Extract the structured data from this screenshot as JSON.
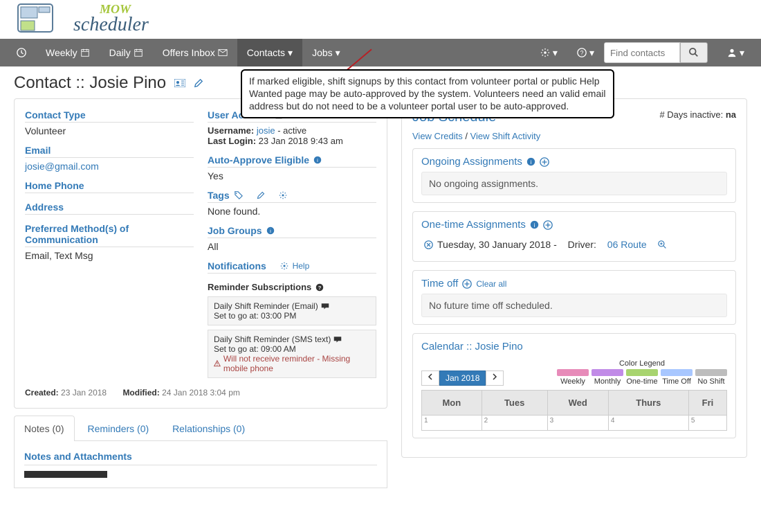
{
  "logo_text_mow": "MOW",
  "logo_text_scheduler": "scheduler",
  "nav": {
    "weekly": "Weekly",
    "daily": "Daily",
    "offers": "Offers Inbox",
    "contacts": "Contacts",
    "jobs": "Jobs",
    "search_placeholder": "Find contacts"
  },
  "tooltip": "If marked eligible, shift signups by this contact from volunteer portal or public Help Wanted page may be auto-approved by the system. Volunteers need an valid email address but do not need to be a volunteer portal user to be auto-approved.",
  "page_title": "Contact :: Josie Pino",
  "left": {
    "contact_type_h": "Contact Type",
    "contact_type": "Volunteer",
    "email_h": "Email",
    "email": "josie@gmail.com",
    "home_phone_h": "Home Phone",
    "address_h": "Address",
    "pref_h": "Preferred Method(s) of Communication",
    "pref": "Email, Text Msg",
    "user_h": "User Account",
    "username_lbl": "Username:",
    "username": "josie",
    "username_status": " - active",
    "lastlogin_lbl": "Last Login:",
    "lastlogin": "23 Jan 2018 9:43 am",
    "auto_h": "Auto-Approve Eligible",
    "auto_v": "Yes",
    "tags_h": "Tags",
    "tags_v": "None found.",
    "jobgroups_h": "Job Groups",
    "jobgroups_v": "All",
    "notif_h": "Notifications",
    "notif_help": "Help",
    "remsub_h": "Reminder Subscriptions",
    "rem1_name": "Daily Shift Reminder (Email)",
    "rem1_time": "Set to go at: 03:00 PM",
    "rem2_name": "Daily Shift Reminder (SMS text)",
    "rem2_time": "Set to go at: 09:00 AM",
    "rem2_warn": "Will not receive reminder - Missing mobile phone",
    "created_lbl": "Created:",
    "created_v": "23 Jan 2018",
    "modified_lbl": "Modified:",
    "modified_v": "24 Jan 2018 3:04 pm"
  },
  "tabs": {
    "notes": "Notes (0)",
    "reminders": "Reminders (0)",
    "relationships": "Relationships (0)",
    "notes_body_h": "Notes and Attachments"
  },
  "right": {
    "jobsched": "Job Schedule",
    "view_credits": "View Credits",
    "sep": " / ",
    "view_activity": "View Shift Activity",
    "days_inactive_lbl": "# Days inactive: ",
    "days_inactive_v": "na",
    "ongoing_h": "Ongoing Assignments",
    "ongoing_body": "No ongoing assignments.",
    "onetime_h": "One-time Assignments",
    "onetime_date": "Tuesday, 30 January 2018 -",
    "onetime_role": "Driver:",
    "onetime_route": "06 Route",
    "timeoff_h": "Time off",
    "timeoff_clear": "Clear all",
    "timeoff_body": "No future time off scheduled.",
    "cal_h": "Calendar :: Josie Pino",
    "month": "Jan 2018",
    "legend_title": "Color Legend",
    "legend": [
      "Weekly",
      "Monthly",
      "One-time",
      "Time Off",
      "No Shift"
    ],
    "legend_colors": [
      "#e78bb9",
      "#c18be7",
      "#a8d46f",
      "#a8c7ff",
      "#bdbdbd"
    ],
    "days": [
      "Mon",
      "Tues",
      "Wed",
      "Thurs",
      "Fri"
    ],
    "date_row": [
      "1",
      "2",
      "3",
      "4",
      "5"
    ]
  }
}
